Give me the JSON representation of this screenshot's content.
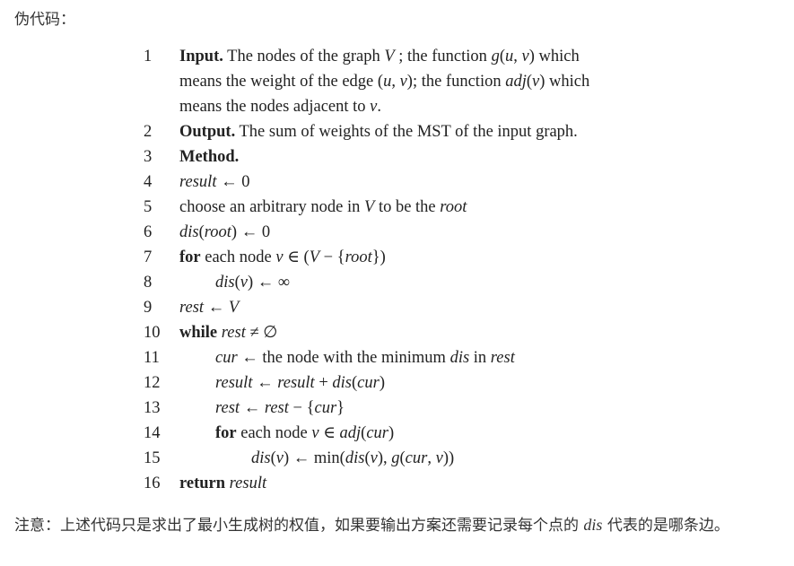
{
  "heading": "伪代码：",
  "algorithm": {
    "lines": [
      {
        "num": "1",
        "indent": 0,
        "rows": [
          [
            {
              "t": "Input.",
              "s": "b"
            },
            {
              "t": " The nodes of the graph "
            },
            {
              "t": "V",
              "s": "i"
            },
            {
              "t": " ; the function "
            },
            {
              "t": "g",
              "s": "i"
            },
            {
              "t": "("
            },
            {
              "t": "u",
              "s": "i"
            },
            {
              "t": ", "
            },
            {
              "t": "v",
              "s": "i"
            },
            {
              "t": ") which"
            }
          ],
          [
            {
              "t": "means the weight of the edge ("
            },
            {
              "t": "u",
              "s": "i"
            },
            {
              "t": ", "
            },
            {
              "t": "v",
              "s": "i"
            },
            {
              "t": "); the function "
            },
            {
              "t": "adj",
              "s": "i"
            },
            {
              "t": "("
            },
            {
              "t": "v",
              "s": "i"
            },
            {
              "t": ") which"
            }
          ],
          [
            {
              "t": "means the nodes adjacent to "
            },
            {
              "t": "v",
              "s": "i"
            },
            {
              "t": "."
            }
          ]
        ]
      },
      {
        "num": "2",
        "indent": 0,
        "rows": [
          [
            {
              "t": "Output.",
              "s": "b"
            },
            {
              "t": " The sum of weights of the MST of the input graph."
            }
          ]
        ]
      },
      {
        "num": "3",
        "indent": 0,
        "rows": [
          [
            {
              "t": "Method.",
              "s": "b"
            }
          ]
        ]
      },
      {
        "num": "4",
        "indent": 0,
        "rows": [
          [
            {
              "t": "result",
              "s": "i"
            },
            {
              "t": " ← 0"
            }
          ]
        ]
      },
      {
        "num": "5",
        "indent": 0,
        "rows": [
          [
            {
              "t": "choose an arbitrary node in "
            },
            {
              "t": "V",
              "s": "i"
            },
            {
              "t": " to be the "
            },
            {
              "t": "root",
              "s": "i"
            }
          ]
        ]
      },
      {
        "num": "6",
        "indent": 0,
        "rows": [
          [
            {
              "t": "dis",
              "s": "i"
            },
            {
              "t": "("
            },
            {
              "t": "root",
              "s": "i"
            },
            {
              "t": ") ← 0"
            }
          ]
        ]
      },
      {
        "num": "7",
        "indent": 0,
        "rows": [
          [
            {
              "t": "for",
              "s": "b"
            },
            {
              "t": " each node "
            },
            {
              "t": "v",
              "s": "i"
            },
            {
              "t": " ∈ ("
            },
            {
              "t": "V",
              "s": "i"
            },
            {
              "t": " − {"
            },
            {
              "t": "root",
              "s": "i"
            },
            {
              "t": "})"
            }
          ]
        ]
      },
      {
        "num": "8",
        "indent": 1,
        "rows": [
          [
            {
              "t": "dis",
              "s": "i"
            },
            {
              "t": "("
            },
            {
              "t": "v",
              "s": "i"
            },
            {
              "t": ") ← ∞"
            }
          ]
        ]
      },
      {
        "num": "9",
        "indent": 0,
        "rows": [
          [
            {
              "t": "rest",
              "s": "i"
            },
            {
              "t": " ← "
            },
            {
              "t": "V",
              "s": "i"
            }
          ]
        ]
      },
      {
        "num": "10",
        "indent": 0,
        "rows": [
          [
            {
              "t": "while",
              "s": "b"
            },
            {
              "t": " "
            },
            {
              "t": "rest",
              "s": "i"
            },
            {
              "t": " ≠ ∅"
            }
          ]
        ]
      },
      {
        "num": "11",
        "indent": 1,
        "rows": [
          [
            {
              "t": "cur",
              "s": "i"
            },
            {
              "t": " ← the node with the minimum "
            },
            {
              "t": "dis",
              "s": "i"
            },
            {
              "t": " in "
            },
            {
              "t": "rest",
              "s": "i"
            }
          ]
        ]
      },
      {
        "num": "12",
        "indent": 1,
        "rows": [
          [
            {
              "t": "result",
              "s": "i"
            },
            {
              "t": " ← "
            },
            {
              "t": "result",
              "s": "i"
            },
            {
              "t": " + "
            },
            {
              "t": "dis",
              "s": "i"
            },
            {
              "t": "("
            },
            {
              "t": "cur",
              "s": "i"
            },
            {
              "t": ")"
            }
          ]
        ]
      },
      {
        "num": "13",
        "indent": 1,
        "rows": [
          [
            {
              "t": "rest",
              "s": "i"
            },
            {
              "t": " ← "
            },
            {
              "t": "rest",
              "s": "i"
            },
            {
              "t": " − {"
            },
            {
              "t": "cur",
              "s": "i"
            },
            {
              "t": "}"
            }
          ]
        ]
      },
      {
        "num": "14",
        "indent": 1,
        "rows": [
          [
            {
              "t": "for",
              "s": "b"
            },
            {
              "t": " each node "
            },
            {
              "t": "v",
              "s": "i"
            },
            {
              "t": " ∈ "
            },
            {
              "t": "adj",
              "s": "i"
            },
            {
              "t": "("
            },
            {
              "t": "cur",
              "s": "i"
            },
            {
              "t": ")"
            }
          ]
        ]
      },
      {
        "num": "15",
        "indent": 2,
        "rows": [
          [
            {
              "t": "dis",
              "s": "i"
            },
            {
              "t": "("
            },
            {
              "t": "v",
              "s": "i"
            },
            {
              "t": ") ← min("
            },
            {
              "t": "dis",
              "s": "i"
            },
            {
              "t": "("
            },
            {
              "t": "v",
              "s": "i"
            },
            {
              "t": "), "
            },
            {
              "t": "g",
              "s": "i"
            },
            {
              "t": "("
            },
            {
              "t": "cur",
              "s": "i"
            },
            {
              "t": ", "
            },
            {
              "t": "v",
              "s": "i"
            },
            {
              "t": "))"
            }
          ]
        ]
      },
      {
        "num": "16",
        "indent": 0,
        "rows": [
          [
            {
              "t": "return",
              "s": "b"
            },
            {
              "t": " "
            },
            {
              "t": "result",
              "s": "i"
            }
          ]
        ]
      }
    ]
  },
  "note": {
    "before": "注意：上述代码只是求出了最小生成树的权值，如果要输出方案还需要记录每个点的 ",
    "var": "dis",
    "after": " 代表的是哪条边。"
  }
}
